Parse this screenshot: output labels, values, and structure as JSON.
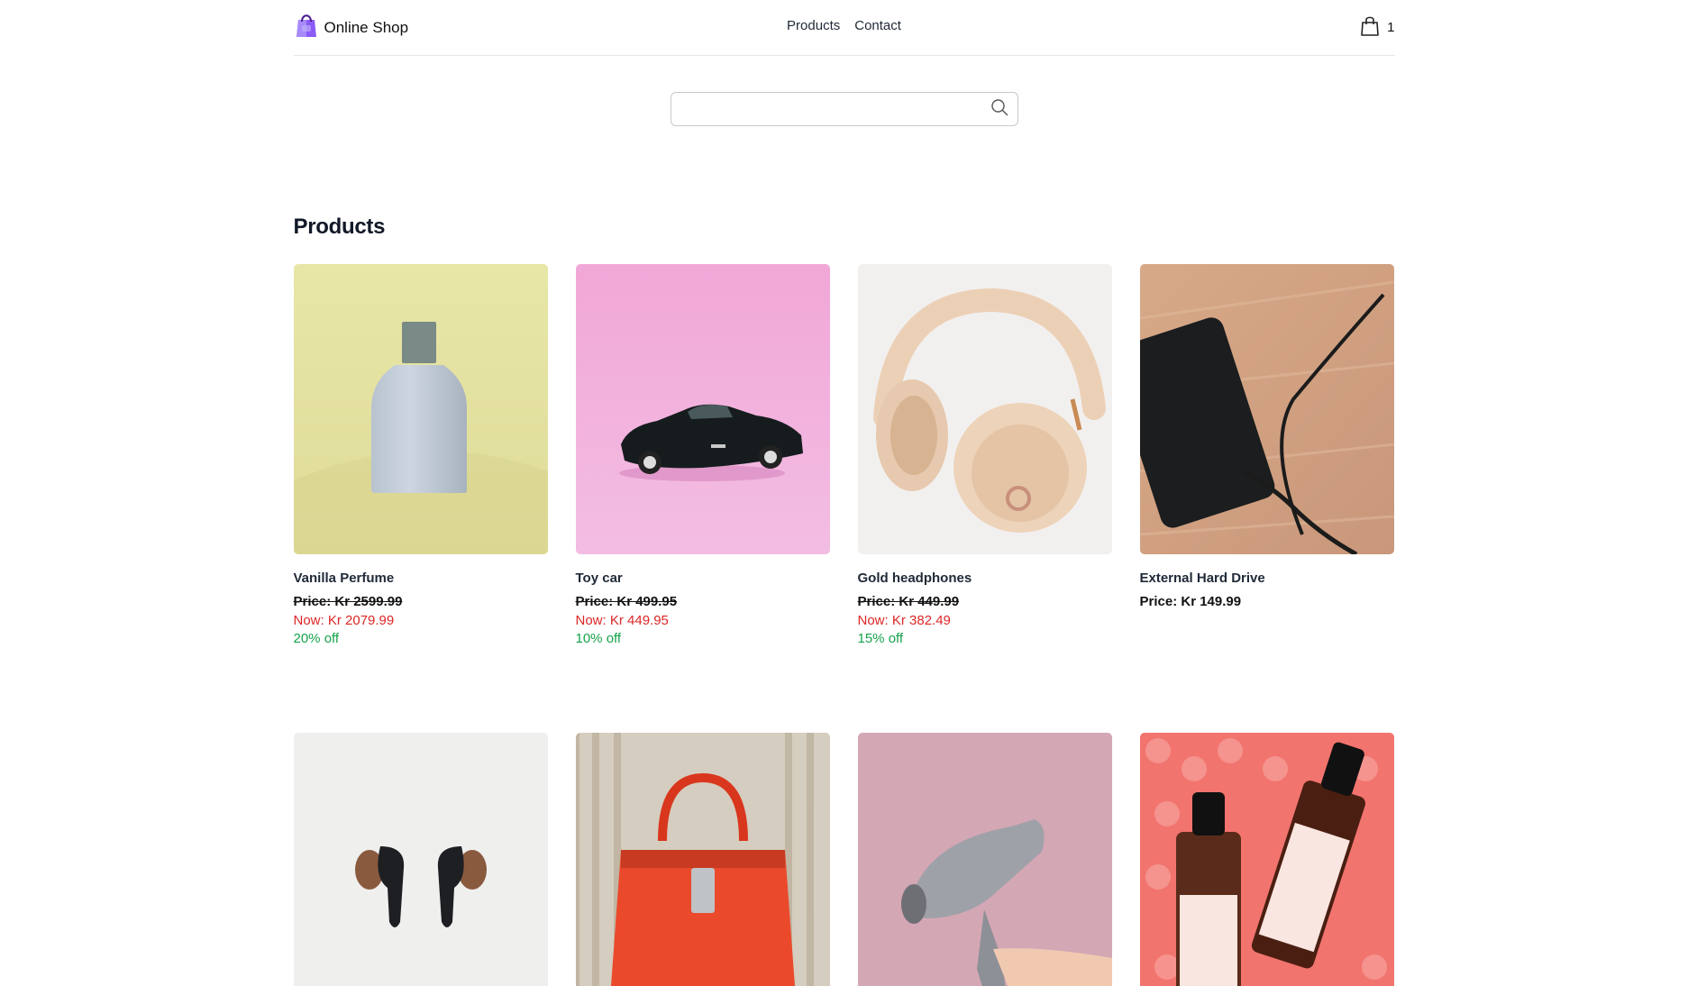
{
  "header": {
    "brand": "Online Shop",
    "nav": [
      "Products",
      "Contact"
    ],
    "cart_count": "1"
  },
  "search": {
    "placeholder": "",
    "value": ""
  },
  "section_title": "Products",
  "products": [
    {
      "name": "Vanilla Perfume",
      "price": "Price: Kr 2599.99",
      "now": "Now: Kr 2079.99",
      "off": "20% off"
    },
    {
      "name": "Toy car",
      "price": "Price: Kr 499.95",
      "now": "Now: Kr 449.95",
      "off": "10% off"
    },
    {
      "name": "Gold headphones",
      "price": "Price: Kr 449.99",
      "now": "Now: Kr 382.49",
      "off": "15% off"
    },
    {
      "name": "External Hard Drive",
      "price": "Price: Kr 149.99"
    },
    {
      "name": ""
    },
    {
      "name": ""
    },
    {
      "name": ""
    },
    {
      "name": ""
    }
  ],
  "colors": {
    "sale_red": "#dc2626",
    "discount_green": "#16a34a",
    "brand_purple": "#7c3aed"
  }
}
